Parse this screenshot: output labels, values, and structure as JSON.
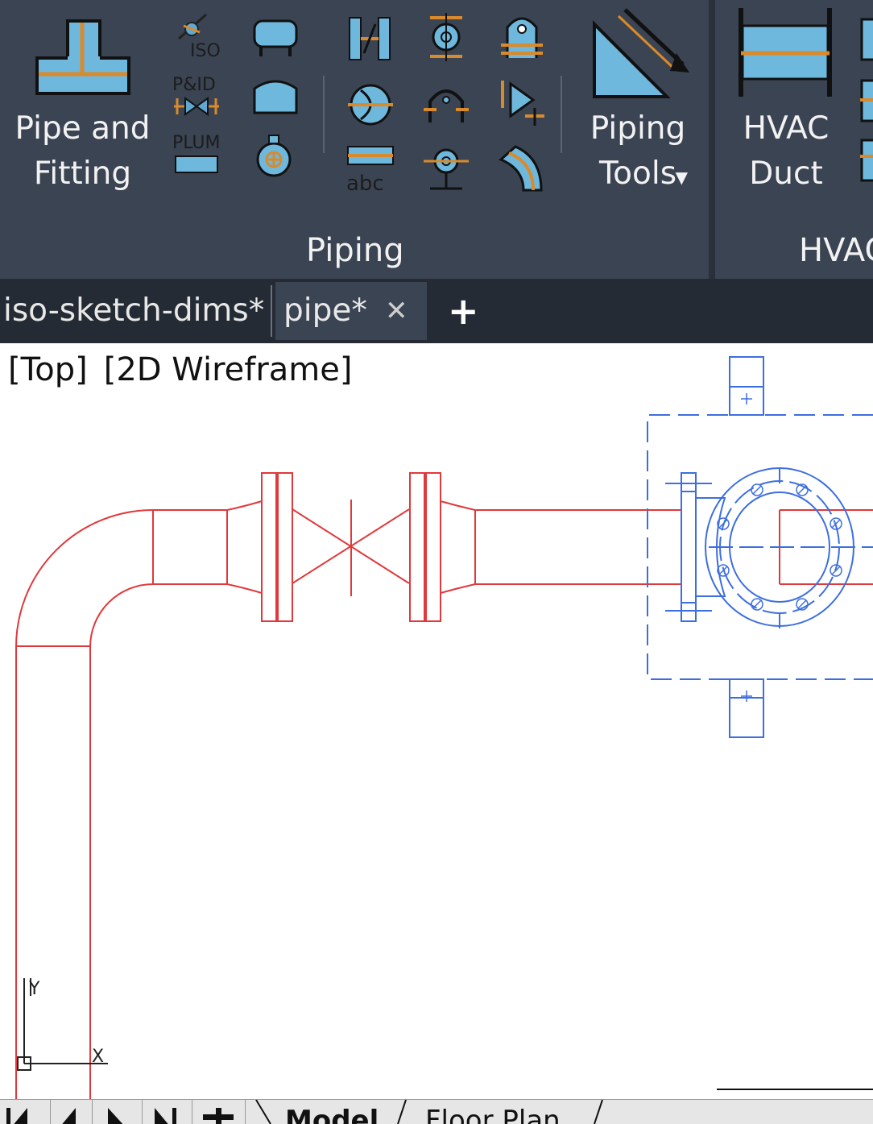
{
  "ribbon": {
    "big_buttons": {
      "pipe_fitting": [
        "Pipe and",
        "Fitting"
      ],
      "piping_tools": [
        "Piping",
        "Tools"
      ],
      "hvac_duct": [
        "HVAC",
        "Duct"
      ]
    },
    "small_icons": {
      "iso_label": "ISO",
      "pid_label": "P&ID",
      "plum_label": "PLUM",
      "abc_label": "abc"
    },
    "panels": {
      "piping": "Piping",
      "hvac": "HVAC"
    },
    "colors": {
      "background": "#3b4453",
      "icon_blue": "#5fa8d3",
      "icon_orange": "#d98a2b"
    }
  },
  "tabs": {
    "documents": [
      {
        "label": "iso-sketch-dims*",
        "active": false
      },
      {
        "label": "pipe*",
        "active": true
      }
    ],
    "close_glyph": "✕",
    "add_glyph": "+"
  },
  "viewport": {
    "view": "[Top]",
    "visual_style": "[2D Wireframe]",
    "ucs": {
      "x_label": "X",
      "y_label": "Y"
    },
    "colors": {
      "pipe": "#e0393b",
      "equipment": "#3d6ee0"
    }
  },
  "layout_tabs": {
    "tabs": [
      "Model",
      "Floor Plan"
    ],
    "active": "Model"
  }
}
